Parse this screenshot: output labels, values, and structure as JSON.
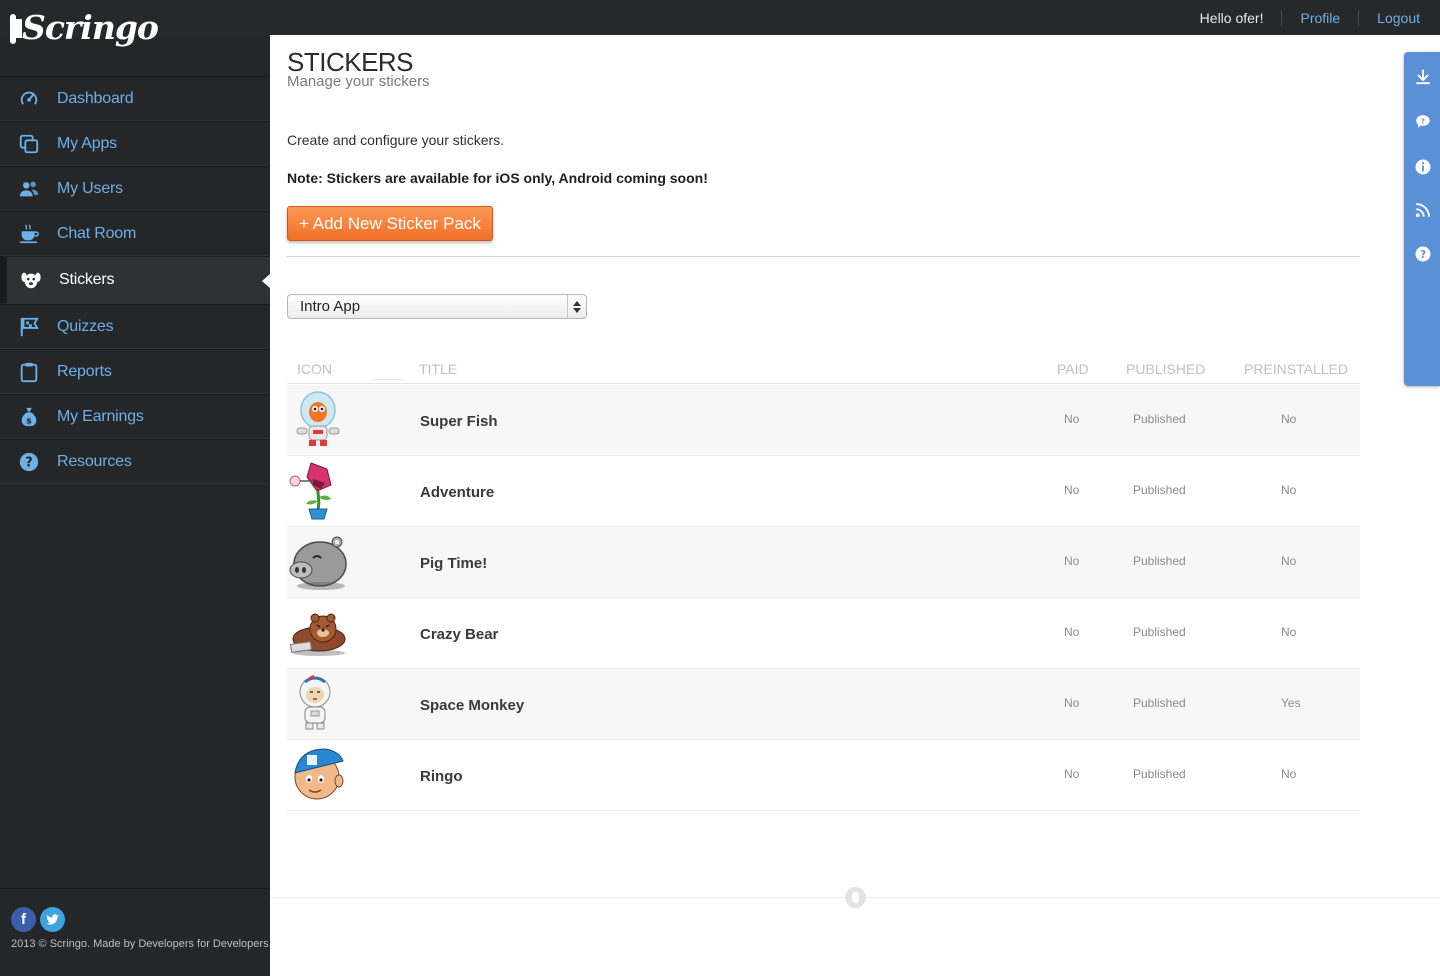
{
  "brand": {
    "name": "Scringo"
  },
  "header": {
    "greeting": "Hello ofer!",
    "profile_label": "Profile",
    "logout_label": "Logout"
  },
  "sidebar": {
    "items": [
      {
        "label": "Dashboard",
        "icon": "dashboard-icon"
      },
      {
        "label": "My Apps",
        "icon": "apps-icon"
      },
      {
        "label": "My Users",
        "icon": "users-icon"
      },
      {
        "label": "Chat Room",
        "icon": "coffee-cup-icon"
      },
      {
        "label": "Stickers",
        "icon": "sticker-dog-icon",
        "active": true
      },
      {
        "label": "Quizzes",
        "icon": "flag-icon"
      },
      {
        "label": "Reports",
        "icon": "clipboard-icon"
      },
      {
        "label": "My Earnings",
        "icon": "money-bag-icon"
      },
      {
        "label": "Resources",
        "icon": "help-icon"
      }
    ],
    "footer_text": "2013 © Scringo. Made by Developers for Developers.",
    "social": [
      "facebook-icon",
      "twitter-icon"
    ]
  },
  "main": {
    "title": "STICKERS",
    "subtitle": "Manage your stickers",
    "intro": "Create and configure your stickers.",
    "note": "Note: Stickers are available for iOS only, Android coming soon!",
    "add_button_label": "+ Add New Sticker Pack",
    "app_select": {
      "selected": "Intro App"
    },
    "table": {
      "headers": {
        "icon": "ICON",
        "title": "TITLE",
        "paid": "PAID",
        "published": "PUBLISHED",
        "preinstalled": "PREINSTALLED"
      },
      "rows": [
        {
          "title": "Super Fish",
          "paid": "No",
          "published": "Published",
          "preinstalled": "No",
          "icon": "super-fish-sticker-icon"
        },
        {
          "title": "Adventure",
          "paid": "No",
          "published": "Published",
          "preinstalled": "No",
          "icon": "adventure-sticker-icon"
        },
        {
          "title": "Pig Time!",
          "paid": "No",
          "published": "Published",
          "preinstalled": "No",
          "icon": "pig-sticker-icon"
        },
        {
          "title": "Crazy Bear",
          "paid": "No",
          "published": "Published",
          "preinstalled": "No",
          "icon": "bear-sticker-icon"
        },
        {
          "title": "Space Monkey",
          "paid": "No",
          "published": "Published",
          "preinstalled": "Yes",
          "icon": "space-monkey-sticker-icon"
        },
        {
          "title": "Ringo",
          "paid": "No",
          "published": "Published",
          "preinstalled": "No",
          "icon": "ringo-sticker-icon"
        }
      ]
    }
  },
  "right_toolbar": {
    "icons": [
      "download-icon",
      "chat-bubble-icon",
      "info-icon",
      "rss-icon",
      "help-icon"
    ]
  },
  "colors": {
    "sidebar_bg": "#242628",
    "link_blue": "#6cb0e8",
    "accent_orange": "#f47f35",
    "toolbar_blue": "#5a90d6"
  }
}
